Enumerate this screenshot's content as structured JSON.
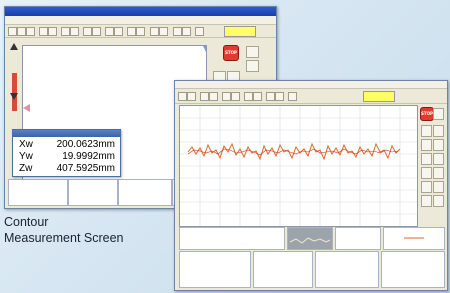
{
  "caption": {
    "line1": "Contour",
    "line2": "Measurement Screen"
  },
  "coordinate_panel": {
    "rows": [
      {
        "axis": "Xw",
        "value": "200.0623mm"
      },
      {
        "axis": "Yw",
        "value": "19.9992mm"
      },
      {
        "axis": "Zw",
        "value": "407.5925mm"
      }
    ]
  },
  "stop_button": {
    "label": "STOP"
  },
  "colors": {
    "stop": "#e23b2d",
    "trace": "#e0662a",
    "status_box": "#ffff66",
    "titlebar": "#2a5bd3"
  }
}
